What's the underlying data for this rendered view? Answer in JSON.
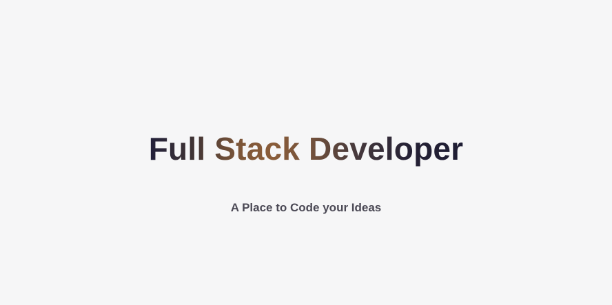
{
  "hero": {
    "title": "Full Stack Developer",
    "subtitle": "A Place to Code your Ideas"
  },
  "colors": {
    "background": "#f6f6f7",
    "title_gradient": [
      "#22203a",
      "#7d5638",
      "#8a5d3a",
      "#46393c",
      "#1d1c33"
    ],
    "subtitle": "#4b4955"
  }
}
